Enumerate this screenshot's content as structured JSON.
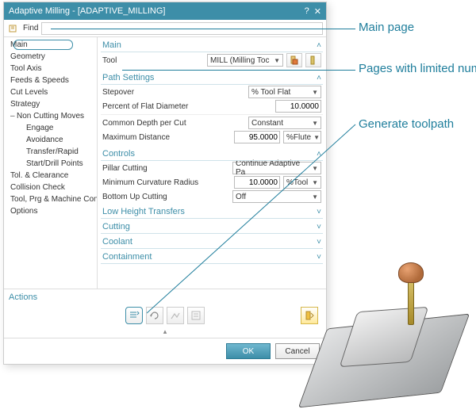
{
  "window": {
    "title": "Adaptive Milling - [ADAPTIVE_MILLING]"
  },
  "find": {
    "label": "Find",
    "value": ""
  },
  "tree": [
    {
      "label": "Main",
      "selected": true
    },
    {
      "label": "Geometry"
    },
    {
      "label": "Tool Axis"
    },
    {
      "label": "Feeds & Speeds"
    },
    {
      "label": "Cut Levels"
    },
    {
      "label": "Strategy"
    },
    {
      "label": "Non Cutting Moves",
      "group": true
    },
    {
      "label": "Engage",
      "sub": 2
    },
    {
      "label": "Avoidance",
      "sub": 2
    },
    {
      "label": "Transfer/Rapid",
      "sub": 2
    },
    {
      "label": "Start/Drill Points",
      "sub": 2
    },
    {
      "label": "Tol. & Clearance"
    },
    {
      "label": "Collision Check"
    },
    {
      "label": "Tool, Prg & Machine Control"
    },
    {
      "label": "Options"
    }
  ],
  "sections": {
    "main": {
      "title": "Main",
      "tool_label": "Tool",
      "tool_value": "MILL (Milling Toc"
    },
    "path": {
      "title": "Path Settings",
      "stepover_label": "Stepover",
      "stepover_value": "% Tool Flat",
      "pfd_label": "Percent of Flat Diameter",
      "pfd_value": "10.0000",
      "depth_label": "Common Depth per Cut",
      "depth_value": "Constant",
      "maxdist_label": "Maximum Distance",
      "maxdist_value": "95.0000",
      "maxdist_unit": "%Flute"
    },
    "controls": {
      "title": "Controls",
      "pillar_label": "Pillar Cutting",
      "pillar_value": "Continue Adaptive Pa",
      "mcr_label": "Minimum Curvature Radius",
      "mcr_value": "10.0000",
      "mcr_unit": "%Tool",
      "buc_label": "Bottom Up Cutting",
      "buc_value": "Off"
    },
    "collapsed": [
      "Low Height Transfers",
      "Cutting",
      "Coolant",
      "Containment"
    ]
  },
  "actions": {
    "title": "Actions"
  },
  "buttons": {
    "ok": "OK",
    "cancel": "Cancel"
  },
  "callouts": {
    "main": "Main page",
    "limited": "Pages with limited number of settings",
    "generate": "Generate toolpath"
  }
}
